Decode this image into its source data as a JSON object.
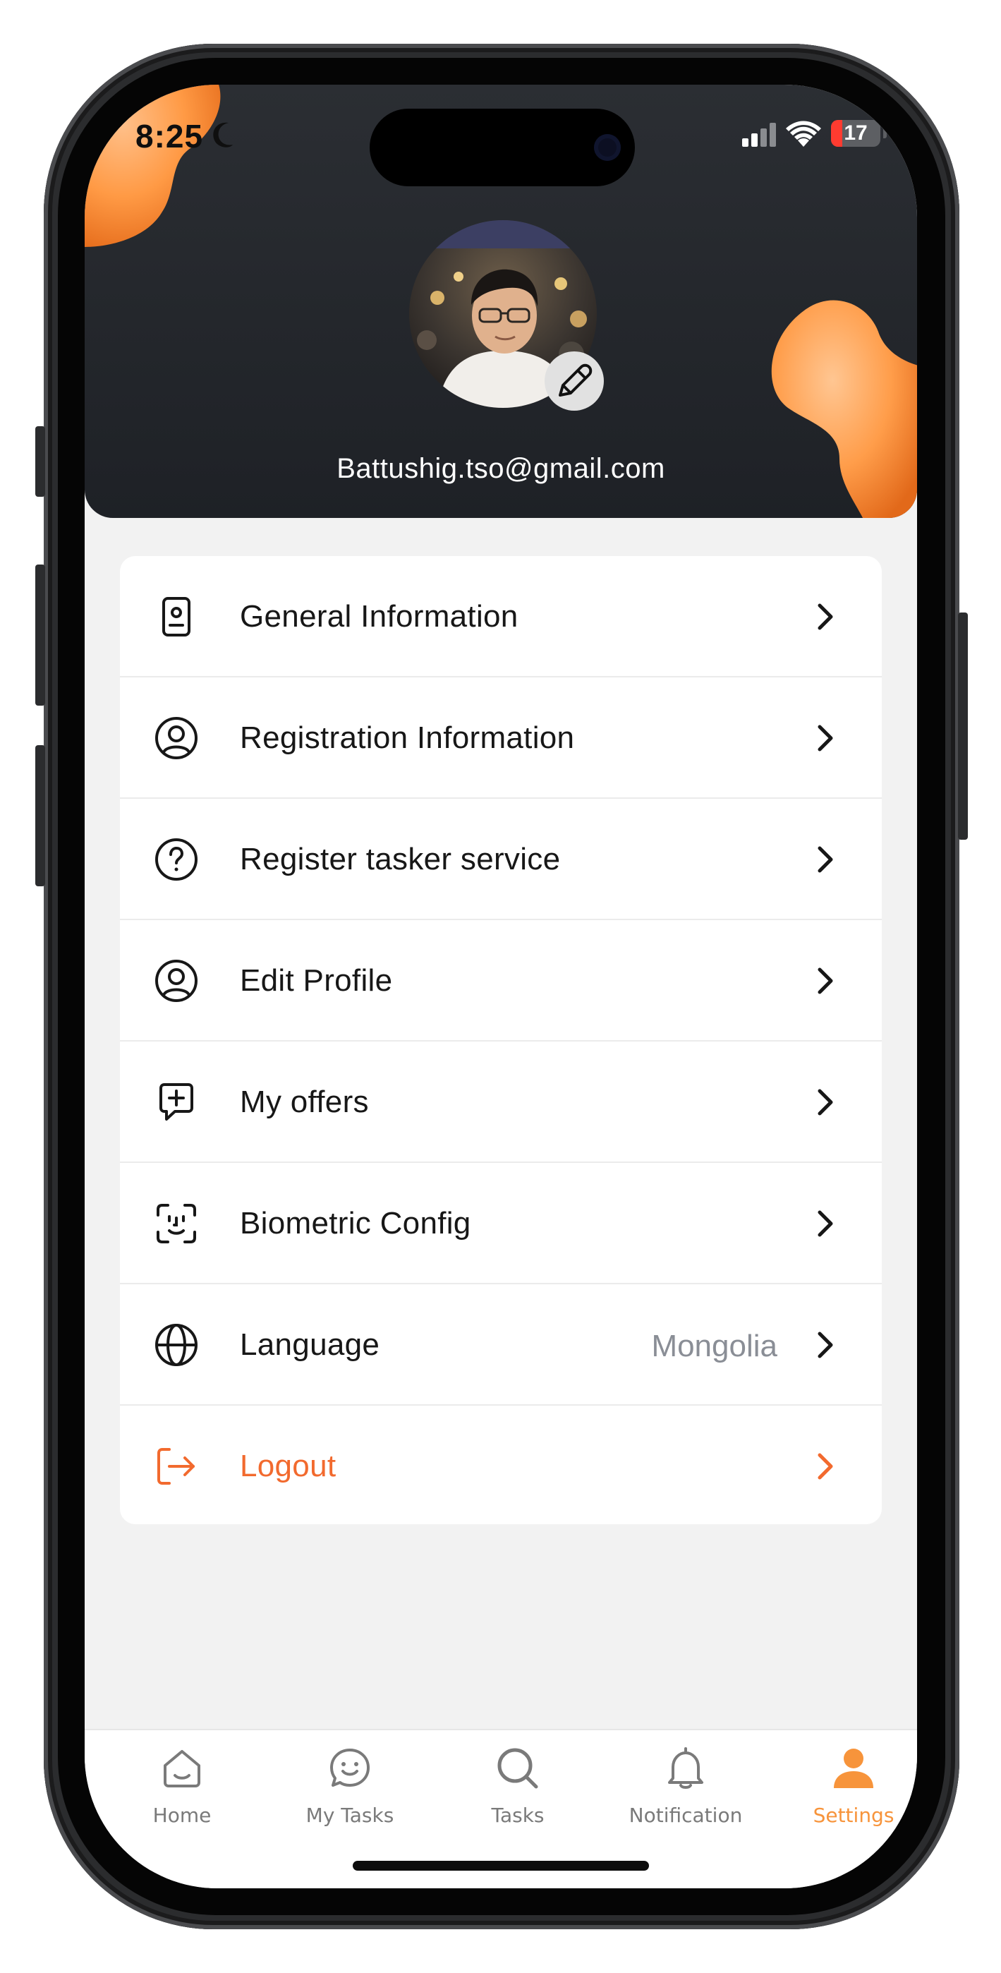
{
  "status_bar": {
    "time": "8:25",
    "battery": "17",
    "icons": [
      "moon-icon",
      "cellular-signal-icon",
      "wifi-icon",
      "battery-icon"
    ]
  },
  "profile": {
    "email": "Battushig.tso@gmail.com",
    "avatar": "profile-photo",
    "edit_icon": "pencil-icon"
  },
  "menu": {
    "items": [
      {
        "label": "General Information",
        "icon": "id-badge-icon"
      },
      {
        "label": "Registration Information",
        "icon": "user-circle-icon"
      },
      {
        "label": "Register tasker service",
        "icon": "help-circle-icon"
      },
      {
        "label": "Edit Profile",
        "icon": "user-circle-icon"
      },
      {
        "label": "My offers",
        "icon": "chat-plus-icon"
      },
      {
        "label": "Biometric Config",
        "icon": "face-id-icon"
      },
      {
        "label": "Language",
        "value": "Mongolia",
        "icon": "globe-icon"
      },
      {
        "label": "Logout",
        "icon": "logout-icon"
      }
    ]
  },
  "tabbar": {
    "tabs": [
      {
        "label": "Home",
        "icon": "home-icon"
      },
      {
        "label": "My Tasks",
        "icon": "smiley-chat-icon"
      },
      {
        "label": "Tasks",
        "icon": "search-icon"
      },
      {
        "label": "Notification",
        "icon": "bell-icon"
      },
      {
        "label": "Settings",
        "icon": "user-icon",
        "active": true
      }
    ]
  },
  "colors": {
    "accent": "#f7943b",
    "logout": "#f26a2e",
    "header_bg": "#24272c",
    "screen_bg": "#f2f2f2"
  }
}
